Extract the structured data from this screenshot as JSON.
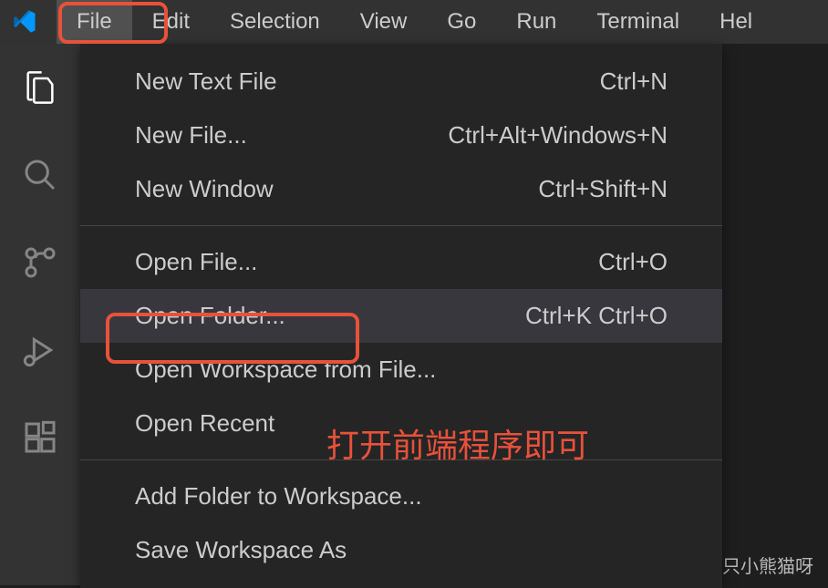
{
  "menubar": {
    "items": [
      "File",
      "Edit",
      "Selection",
      "View",
      "Go",
      "Run",
      "Terminal",
      "Hel"
    ]
  },
  "dropdown": {
    "groups": [
      [
        {
          "label": "New Text File",
          "shortcut": "Ctrl+N"
        },
        {
          "label": "New File...",
          "shortcut": "Ctrl+Alt+Windows+N"
        },
        {
          "label": "New Window",
          "shortcut": "Ctrl+Shift+N"
        }
      ],
      [
        {
          "label": "Open File...",
          "shortcut": "Ctrl+O"
        },
        {
          "label": "Open Folder...",
          "shortcut": "Ctrl+K Ctrl+O",
          "highlighted": true
        },
        {
          "label": "Open Workspace from File...",
          "shortcut": ""
        },
        {
          "label": "Open Recent",
          "shortcut": "",
          "submenu": true
        }
      ],
      [
        {
          "label": "Add Folder to Workspace...",
          "shortcut": ""
        },
        {
          "label": "Save Workspace As",
          "shortcut": ""
        }
      ]
    ]
  },
  "annotation": "打开前端程序即可",
  "watermark": "CSDN @一只小熊猫呀",
  "activity": {
    "icons": [
      "files-icon",
      "search-icon",
      "source-control-icon",
      "debug-icon",
      "extensions-icon"
    ]
  }
}
